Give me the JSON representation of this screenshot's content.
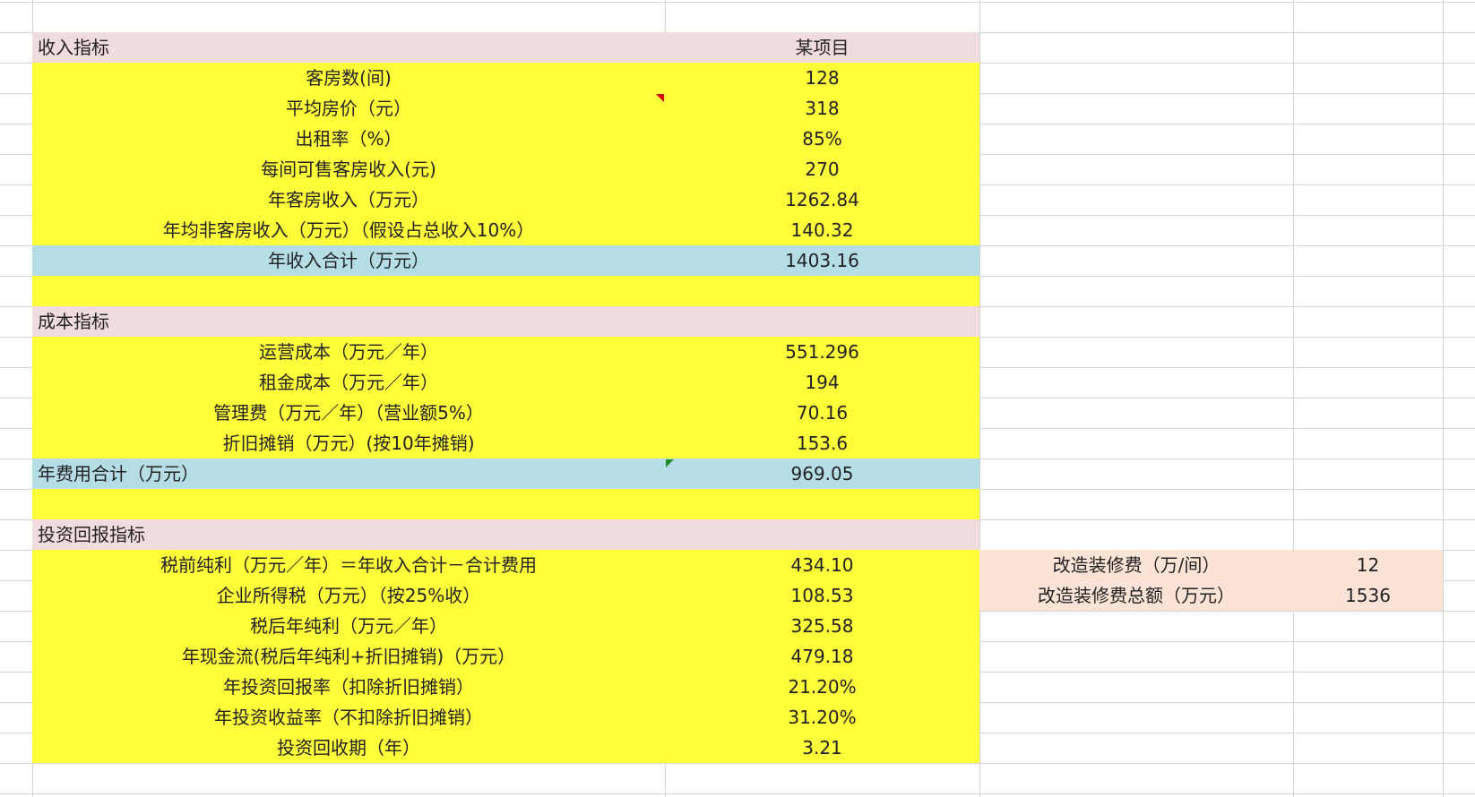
{
  "income": {
    "header": {
      "label": "收入指标",
      "value": "某项目"
    },
    "rows": [
      {
        "label": "客房数(间)",
        "value": "128"
      },
      {
        "label": "平均房价（元）",
        "value": "318"
      },
      {
        "label": "出租率（%）",
        "value": "85%"
      },
      {
        "label": "每间可售客房收入(元)",
        "value": "270"
      },
      {
        "label": "年客房收入（万元）",
        "value": "1262.84"
      },
      {
        "label": "年均非客房收入（万元）（假设占总收入10%）",
        "value": "140.32"
      }
    ],
    "total": {
      "label": "年收入合计（万元）",
      "value": "1403.16"
    }
  },
  "cost": {
    "header": {
      "label": "成本指标"
    },
    "rows": [
      {
        "label": "运营成本（万元／年）",
        "value": "551.296"
      },
      {
        "label": "租金成本（万元／年）",
        "value": "194"
      },
      {
        "label": "管理费（万元／年）（营业额5%）",
        "value": "70.16"
      },
      {
        "label": "折旧摊销（万元）(按10年摊销)",
        "value": "153.6"
      }
    ],
    "total": {
      "label": "年费用合计（万元）",
      "value": "969.05"
    }
  },
  "investment": {
    "header": {
      "label": "投资回报指标"
    },
    "rows": [
      {
        "label": "税前纯利（万元／年）＝年收入合计－合计费用",
        "value": "434.10"
      },
      {
        "label": "企业所得税（万元）（按25%收）",
        "value": "108.53"
      },
      {
        "label": "税后年纯利（万元／年）",
        "value": "325.58"
      },
      {
        "label": "年现金流(税后年纯利+折旧摊销)（万元）",
        "value": "479.18"
      },
      {
        "label": "年投资回报率（扣除折旧摊销）",
        "value": "21.20%"
      },
      {
        "label": "年投资收益率（不扣除折旧摊销）",
        "value": "31.20%"
      },
      {
        "label": "投资回收期（年）",
        "value": "3.21"
      }
    ]
  },
  "renovation": {
    "rows": [
      {
        "label": "改造装修费（万/间）",
        "value": "12"
      },
      {
        "label": "改造装修费总额（万元）",
        "value": "1536"
      }
    ]
  },
  "colors": {
    "header_bg": "#f0dcdc",
    "data_bg": "#ffff3a",
    "total_bg": "#b5dde6",
    "side_bg": "#fbe4d6"
  }
}
